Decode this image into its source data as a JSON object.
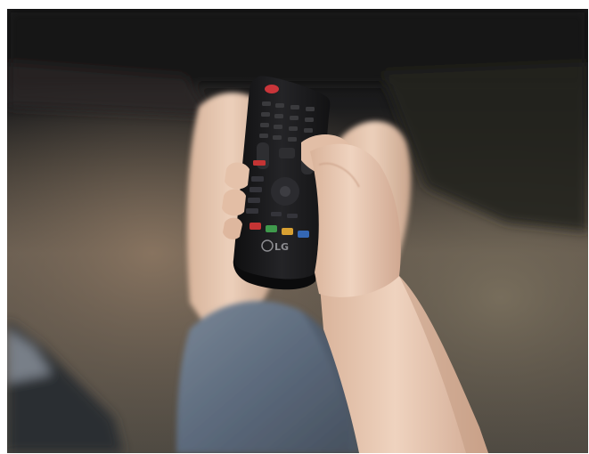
{
  "photo": {
    "subject": "hand-holding-tv-remote",
    "brand_text": "LG",
    "colors": {
      "background_dark": "#1d1d1f",
      "floor_mid": "#6e6355",
      "skin": "#e7c5ad",
      "skin_shadow": "#c99e85",
      "remote_body": "#1b1b1d",
      "jeans": "#5f6d80"
    },
    "buttons": {
      "power": "#c9353a",
      "red": "#c43434",
      "green": "#3f9a4c",
      "yellow": "#d8a032",
      "blue": "#3467b4"
    }
  }
}
